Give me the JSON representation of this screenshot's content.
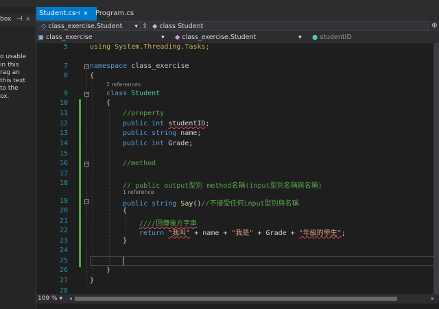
{
  "toolbox": {
    "header_label": "box",
    "body_lines": [
      "o usable",
      "in this",
      "rag an",
      "this text",
      "to the",
      "ox."
    ]
  },
  "tabs": [
    {
      "label": "Student.cs",
      "active": true,
      "pin_glyph": "⊣",
      "close_glyph": "×"
    },
    {
      "label": "Program.cs",
      "active": false
    }
  ],
  "navbar": {
    "project_combo": "class_exercise.Student",
    "class_combo": "class Student"
  },
  "navbar2": {
    "scope": "class_exercise",
    "type": "class_exercise.Student",
    "member": "studentID"
  },
  "code": {
    "line_numbers": [
      "5",
      "7",
      "8",
      "9",
      "10",
      "11",
      "12",
      "13",
      "14",
      "15",
      "16",
      "17",
      "18",
      "19",
      "20",
      "21",
      "22",
      "23",
      "24",
      "25",
      "26",
      "27",
      "28"
    ],
    "refs": {
      "class_refs": "2 references",
      "method_refs": "1 reference"
    },
    "l5": "using System.Threading.Tasks;",
    "l7_kw": "namespace",
    "l7_name": " class_exercise",
    "l8": "{",
    "l9_kw": "class",
    "l9_name": " Student",
    "l10": "{",
    "l11": "//property",
    "l12_kw": "public int ",
    "l12_name": "studentID",
    "l12_end": ";",
    "l13_kw": "public string ",
    "l13_name": "name;",
    "l14_kw": "public int ",
    "l14_name": "Grade;",
    "l16": "//method",
    "l18": "// public output型別 method名稱(input型別名稱與名稱)",
    "l19_kw": "public string ",
    "l19_me": "Say",
    "l19_paren": "()",
    "l19_cm": "//不接受任何input型別與名稱",
    "l20": "{",
    "l21_cm": "////回傳後方字串",
    "l22_kw": "return ",
    "l22_s1": "\"我叫\"",
    "l22_p1": " + name + ",
    "l22_s2": "\"我是\"",
    "l22_p2": " + Grade + ",
    "l22_s3": "\"年級的學生\"",
    "l22_end": ";",
    "l23": "}",
    "l26": "}",
    "l27": "}"
  },
  "status": {
    "zoom": "109 %"
  },
  "colors": {
    "accent": "#007acc",
    "keyword": "#569cd6",
    "type": "#4ec9b0",
    "comment": "#57a64a",
    "string": "#d69d85"
  }
}
